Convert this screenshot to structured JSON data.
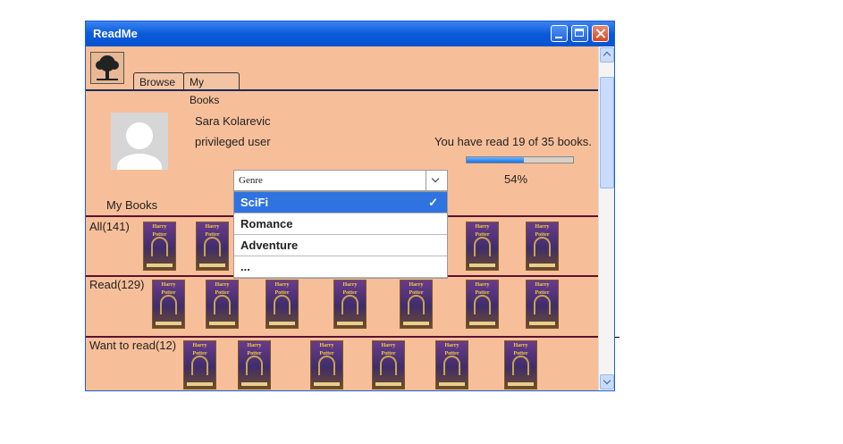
{
  "window": {
    "title": "ReadMe"
  },
  "nav": {
    "tabs": [
      "Browse",
      "My Books"
    ]
  },
  "profile": {
    "name": "Sara Kolarevic",
    "role": "privileged user",
    "read_summary": "You have read 19 of 35 books.",
    "progress_fraction": 0.54,
    "progress_label": "54%"
  },
  "library": {
    "heading": "My Books"
  },
  "genre_select": {
    "value": "Genre",
    "options": [
      "SciFi",
      "Romance",
      "Adventure",
      "..."
    ],
    "selected": "SciFi",
    "check": "✓"
  },
  "shelves": [
    {
      "label": "All(141)"
    },
    {
      "label": "Read(129)"
    },
    {
      "label": "Want to read(12)"
    }
  ],
  "book_cover_title": "Harry Potter",
  "colors": {
    "accent": "#2f73e0",
    "window_bg": "#f7bf99"
  }
}
